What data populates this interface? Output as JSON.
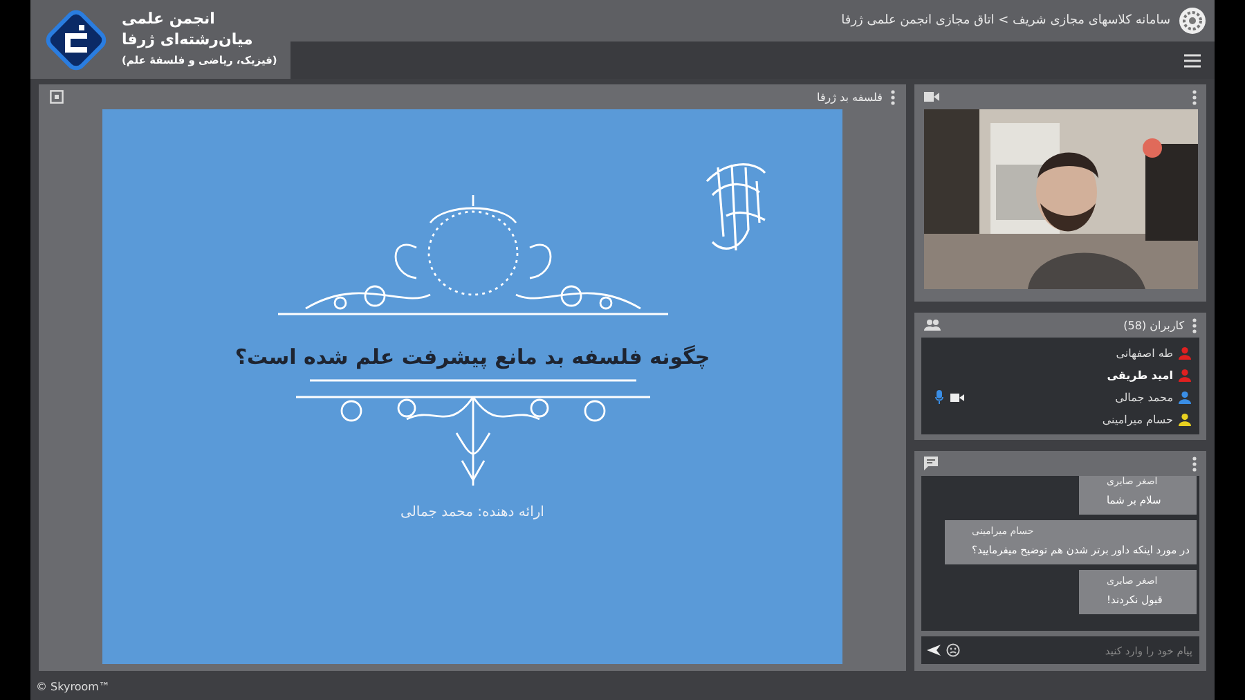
{
  "brand": {
    "lines": [
      "انجمن علمی",
      "میان‌رشته‌ای ژرفا",
      "(فیزیک، ریاضی و فلسفهٔ علم)"
    ]
  },
  "breadcrumb": "سامانه کلاسهای مجازی شریف > اتاق مجازی انجمن علمی ژرفا",
  "presentation": {
    "title": "فلسفه بد ژرفا",
    "slide": {
      "heading": "چگونه فلسفه بد مانع پیشرفت علم شده است؟",
      "presenter": "ارائه دهنده: محمد جمالی"
    }
  },
  "users": {
    "title": "کاربران (58)",
    "items": [
      {
        "name": "طه اصفهانی",
        "color": "#e02020",
        "active": false,
        "mic": false,
        "camera": false
      },
      {
        "name": "امید طریقی",
        "color": "#e02020",
        "active": true,
        "mic": false,
        "camera": false
      },
      {
        "name": "محمد جمالی",
        "color": "#3a8ee6",
        "active": false,
        "mic": true,
        "camera": true
      },
      {
        "name": "حسام میرامینی",
        "color": "#e8d020",
        "active": false,
        "mic": false,
        "camera": false
      }
    ]
  },
  "chat": {
    "messages": [
      {
        "sender": "اصغر صابری",
        "text": "سلام بر شما"
      },
      {
        "sender": "حسام میرامینی",
        "text": "در مورد اینکه داور برتر شدن هم توضیح میفرمایید؟"
      },
      {
        "sender": "اصغر صابری",
        "text": "قبول نکردند!"
      }
    ],
    "input": {
      "placeholder": "پیام خود را وارد کنید"
    }
  },
  "footer": "© Skyroom™"
}
